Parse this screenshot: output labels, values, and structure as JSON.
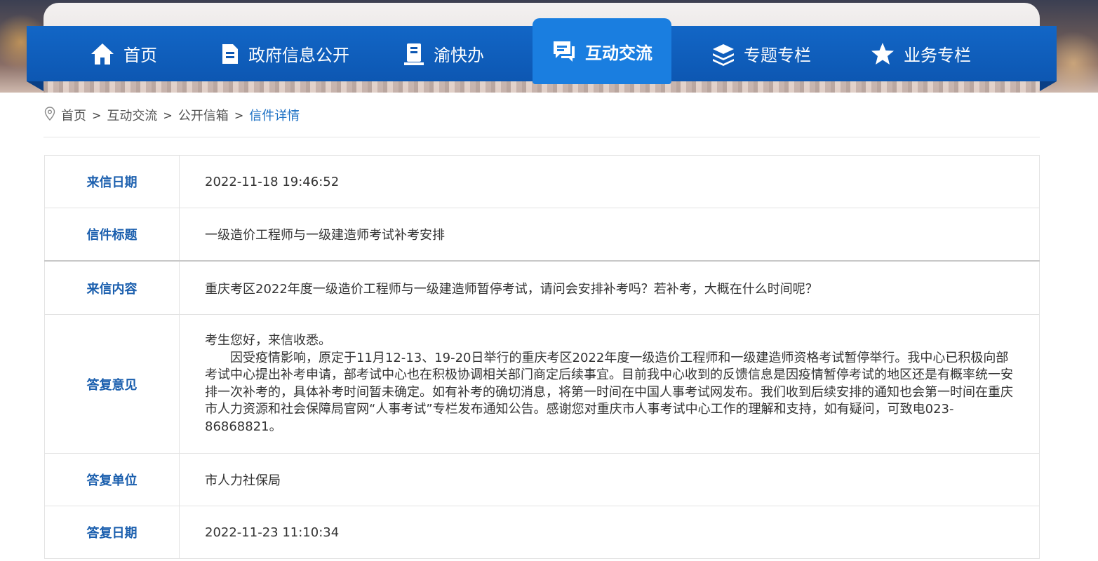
{
  "nav": {
    "items": [
      {
        "label": "首页",
        "icon": "home-icon"
      },
      {
        "label": "政府信息公开",
        "icon": "document-icon"
      },
      {
        "label": "渝快办",
        "icon": "book-icon"
      },
      {
        "label": "互动交流",
        "icon": "chat-icon",
        "active": true
      },
      {
        "label": "专题专栏",
        "icon": "layers-icon"
      },
      {
        "label": "业务专栏",
        "icon": "star-icon"
      }
    ]
  },
  "breadcrumb": {
    "items": [
      "首页",
      "互动交流",
      "公开信箱"
    ],
    "current": "信件详情",
    "separator": ">"
  },
  "detail": {
    "letter_date_label": "来信日期",
    "letter_date": "2022-11-18 19:46:52",
    "title_label": "信件标题",
    "title": "一级造价工程师与一级建造师考试补考安排",
    "content_label": "来信内容",
    "content": "重庆考区2022年度一级造价工程师与一级建造师暂停考试，请问会安排补考吗？若补考，大概在什么时间呢？",
    "reply_label": "答复意见",
    "reply_greeting": "考生您好，来信收悉。",
    "reply_body": "因受疫情影响，原定于11月12-13、19-20日举行的重庆考区2022年度一级造价工程师和一级建造师资格考试暂停举行。我中心已积极向部考试中心提出补考申请，部考试中心也在积极协调相关部门商定后续事宜。目前我中心收到的反馈信息是因疫情暂停考试的地区还是有概率统一安排一次补考的，具体补考时间暂未确定。如有补考的确切消息，将第一时间在中国人事考试网发布。我们收到后续安排的通知也会第一时间在重庆市人力资源和社会保障局官网“人事考试”专栏发布通知公告。感谢您对重庆市人事考试中心工作的理解和支持，如有疑问，可致电023-86868821。",
    "reply_unit_label": "答复单位",
    "reply_unit": "市人力社保局",
    "reply_date_label": "答复日期",
    "reply_date": "2022-11-23 11:10:34"
  },
  "colors": {
    "nav_bg": "#0d57b2",
    "nav_active": "#1a7ee0",
    "label_text": "#1b5fae",
    "breadcrumb_current": "#1a6fc4"
  }
}
